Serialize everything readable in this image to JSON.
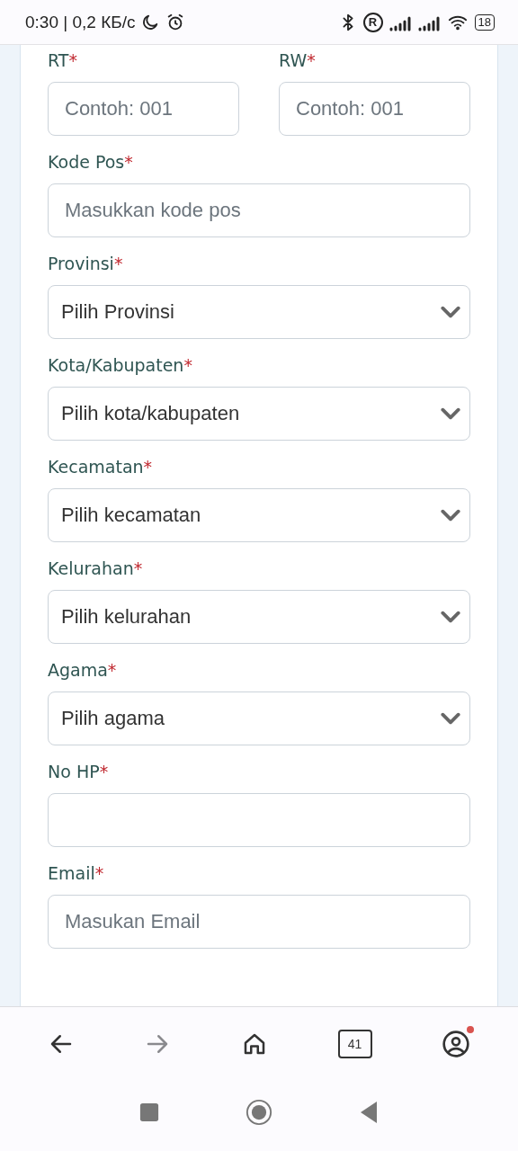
{
  "status_bar": {
    "time": "0:30 | 0,2 КБ/с",
    "roaming": "R",
    "battery": "18"
  },
  "fields": [
    {
      "kind": "pair",
      "items": [
        {
          "label": "RT",
          "mark": "*",
          "kind": "text",
          "placeholder": "Contoh: 001"
        },
        {
          "label": "RW",
          "mark": "*",
          "kind": "text",
          "placeholder": "Contoh: 001"
        }
      ]
    },
    {
      "kind": "text",
      "label": "Kode Pos",
      "mark": "*",
      "placeholder": "Masukkan kode pos"
    },
    {
      "kind": "select",
      "label": "Provinsi",
      "mark": "*",
      "value": "Pilih Provinsi"
    },
    {
      "kind": "select",
      "label": "Kota/Kabupaten",
      "mark": "*",
      "value": "Pilih kota/kabupaten"
    },
    {
      "kind": "select",
      "label": "Kecamatan",
      "mark": "*",
      "value": "Pilih kecamatan"
    },
    {
      "kind": "select",
      "label": "Kelurahan",
      "mark": "*",
      "value": "Pilih kelurahan"
    },
    {
      "kind": "select",
      "label": "Agama",
      "mark": "*",
      "value": "Pilih agama"
    },
    {
      "kind": "text",
      "label": "No HP",
      "mark": "*"
    },
    {
      "kind": "text",
      "label": "Email",
      "mark": "*",
      "placeholder": "Masukan Email"
    }
  ],
  "browser_bar": {
    "forward_disabled": true,
    "tab_count": "41",
    "profile_notification": true
  }
}
